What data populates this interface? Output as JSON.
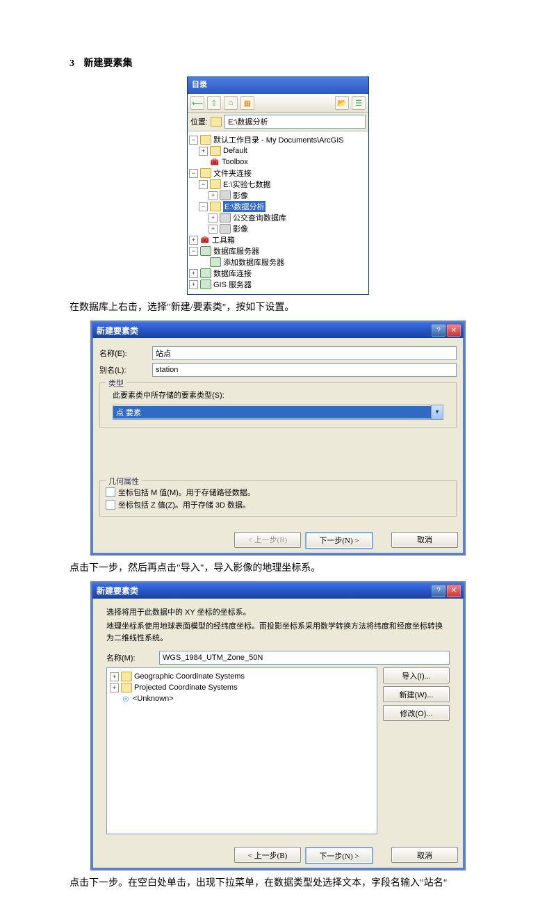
{
  "heading_num": "3",
  "heading_text": "新建要素集",
  "catalog": {
    "title": "目录",
    "location_label": "位置:",
    "location_value": "E:\\数据分析",
    "tree": {
      "root": "默认工作目录 - My Documents\\ArcGIS",
      "default": "Default",
      "toolbox": "Toolbox",
      "folder_conn": "文件夹连接",
      "exp7": "E:\\实验七数据",
      "image1": "影像",
      "data_analysis": "E:\\数据分析",
      "bus_gdb": "公交查询数据库",
      "image2": "影像",
      "toolkit": "工具箱",
      "db_servers": "数据库服务器",
      "add_db_server": "添加数据库服务器",
      "db_conn": "数据库连接",
      "gis_servers": "GIS 服务器"
    }
  },
  "para1": "在数据库上右击，选择\"新建/要素类\"，按如下设置。",
  "dlg1": {
    "title": "新建要素类",
    "name_lbl": "名称(E):",
    "name_val": "站点",
    "alias_lbl": "别名(L):",
    "alias_val": "station",
    "type_legend": "类型",
    "type_hint": "此要素类中所存储的要素类型(S):",
    "type_val": "点 要素",
    "geom_legend": "几何属性",
    "m_chk": "坐标包括 M 值(M)。用于存储路径数据。",
    "z_chk": "坐标包括 Z 值(Z)。用于存储 3D 数据。",
    "back_btn": "< 上一步(B)",
    "next_btn": "下一步(N) >",
    "cancel_btn": "取消"
  },
  "para2": "点击下一步，然后再点击\"导入\"，导入影像的地理坐标系。",
  "dlg2": {
    "title": "新建要素类",
    "hint1": "选择将用于此数据中的 XY 坐标的坐标系。",
    "hint2": "地理坐标系使用地球表面模型的经纬度坐标。而投影坐标系采用数学转换方法将纬度和经度坐标转换为二维线性系统。",
    "name_lbl": "名称(M):",
    "name_val": "WGS_1984_UTM_Zone_50N",
    "gcs": "Geographic Coordinate Systems",
    "pcs": "Projected Coordinate Systems",
    "unknown": "<Unknown>",
    "import_btn": "导入(I)...",
    "new_btn": "新建(W)...",
    "modify_btn": "修改(O)...",
    "back_btn": "< 上一步(B)",
    "next_btn": "下一步(N) >",
    "cancel_btn": "取消"
  },
  "para3": "点击下一步。在空白处单击，出现下拉菜单，在数据类型处选择文本，字段名输入\"站名\""
}
